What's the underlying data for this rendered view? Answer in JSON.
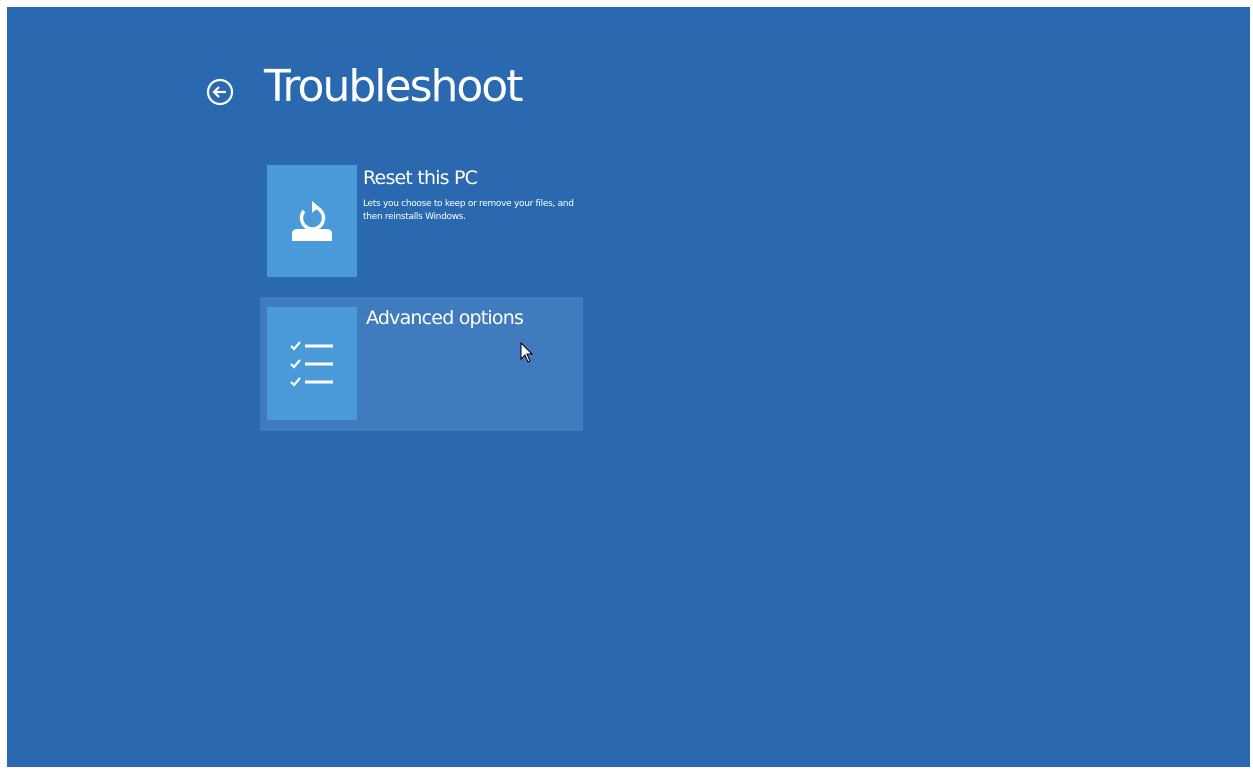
{
  "page": {
    "title": "Troubleshoot",
    "background_color": "#2a69b0"
  },
  "back_button": {
    "icon": "back-arrow-circle-icon"
  },
  "options": [
    {
      "title": "Reset this PC",
      "description": "Lets you choose to keep or remove your files, and then reinstalls Windows.",
      "icon": "reset-pc-icon",
      "state": "normal"
    },
    {
      "title": "Advanced options",
      "description": "",
      "icon": "checklist-icon",
      "state": "hover"
    }
  ],
  "colors": {
    "tile_icon": "#4a9ad9",
    "tile_hover": "#3f7bbd",
    "text": "#ffffff"
  }
}
